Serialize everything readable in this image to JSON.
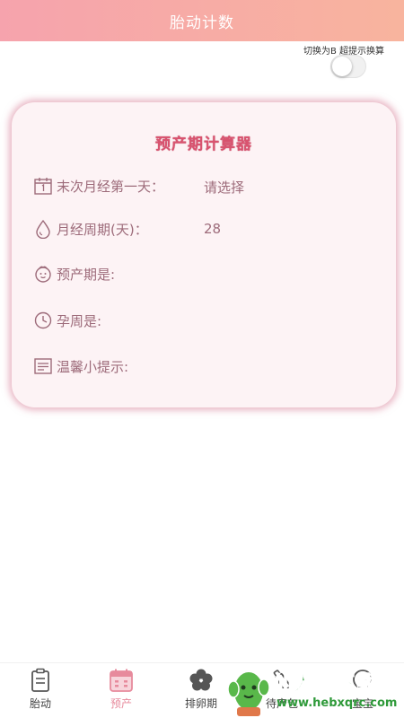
{
  "header": {
    "title": "胎动计数"
  },
  "toggle": {
    "hint": "切换为B 超提示换算",
    "on": false
  },
  "card": {
    "title": "预产期计算器",
    "rows": [
      {
        "label": "末次月经第一天：",
        "value": "请选择",
        "icon": "calendar-icon"
      },
      {
        "label": "月经周期(天)：",
        "value": "28",
        "icon": "droplet-icon"
      },
      {
        "label": "预产期是:",
        "value": "",
        "icon": "baby-face-icon"
      },
      {
        "label": "孕周是:",
        "value": "",
        "icon": "clock-icon"
      },
      {
        "label": "温馨小提示:",
        "value": "",
        "icon": "notes-icon"
      }
    ]
  },
  "tabbar": {
    "active": "预产",
    "tabs": [
      {
        "label": "胎动",
        "icon": "clipboard-icon"
      },
      {
        "label": "预产",
        "icon": "calendar-grid-icon"
      },
      {
        "label": "排卵期",
        "icon": "flower-icon"
      },
      {
        "label": "待产包",
        "icon": "bottle-icon"
      },
      {
        "label": "宝宝",
        "icon": "baby-icon"
      }
    ]
  },
  "watermark": {
    "text": "仙人掌下载网",
    "url": "www.hebxqrc.com"
  },
  "colors": {
    "header_start": "#f6a3ad",
    "header_end": "#f8b49e",
    "accent": "#d9536f",
    "label": "#9d6b7a",
    "active_tab": "#e78a9c"
  }
}
